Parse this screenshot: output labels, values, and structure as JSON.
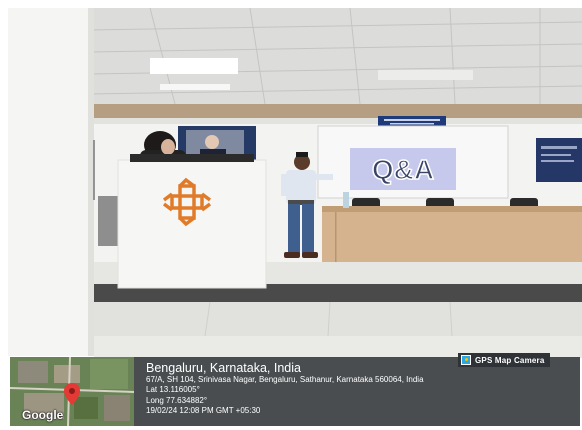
{
  "scene": {
    "description_icons": [
      "podium-knot-logo",
      "q-and-a-slide",
      "speaker-person",
      "audience-person",
      "ceiling-lights"
    ],
    "slide_text": "Q&A",
    "colors": {
      "wall": "#f1f1ef",
      "ceiling": "#dcdcd8",
      "podium_logo": "#e07b2a",
      "stage": "#d9b894",
      "screen": "#c9cbea"
    }
  },
  "geotag": {
    "camera_badge": "GPS Map Camera",
    "map_logo": "Google",
    "city": "Bengaluru, Karnataka, India",
    "address": "67/A, SH 104, Srinivasa Nagar, Bengaluru, Sathanur, Karnataka 560064, India",
    "lat": "Lat 13.116005°",
    "long": "Long 77.634882°",
    "datetime": "19/02/24 12:08 PM GMT +05:30"
  }
}
